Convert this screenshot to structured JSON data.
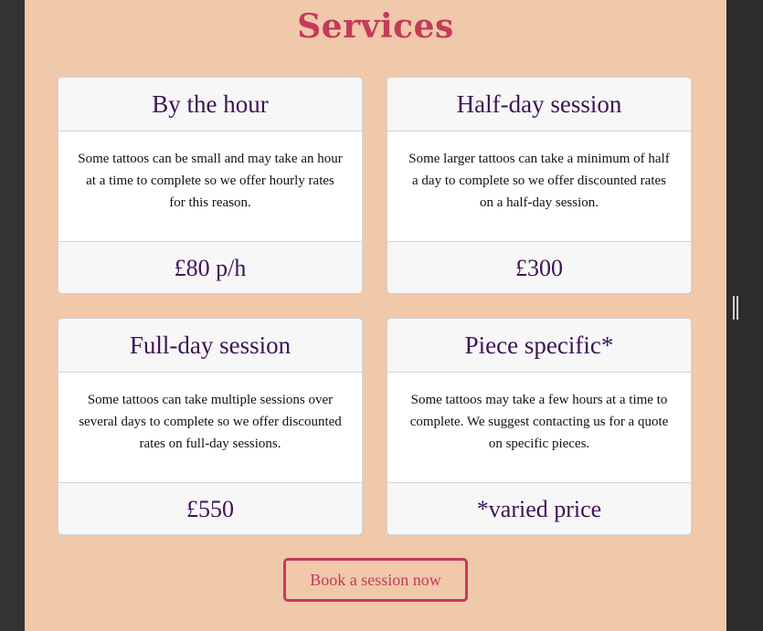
{
  "section": {
    "title": "Services"
  },
  "services": [
    {
      "title": "By the hour",
      "description": "Some tattoos can be small and may take an hour at a time to complete so we offer hourly rates for this reason.",
      "price": "£80 p/h"
    },
    {
      "title": "Half-day session",
      "description": "Some larger tattoos can take a minimum of half a day to complete so we offer discounted rates on a half-day session.",
      "price": "£300"
    },
    {
      "title": "Full-day session",
      "description": "Some tattoos can take multiple sessions over several days to complete so we offer discounted rates on full-day sessions.",
      "price": "£550"
    },
    {
      "title": "Piece specific*",
      "description": "Some tattoos may take a few hours at a time to complete. We suggest contacting us for a quote on specific pieces.",
      "price": "*varied price"
    }
  ],
  "cta": {
    "label": "Book a session now"
  },
  "colors": {
    "page_background": "#f0c8aa",
    "accent": "#c43a5b",
    "heading_text": "#3e1456",
    "chrome": "#333333"
  }
}
